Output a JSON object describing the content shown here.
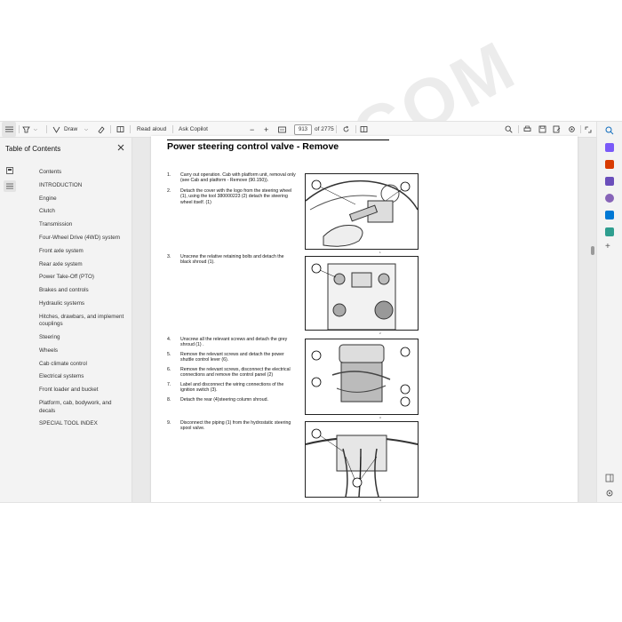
{
  "toolbar": {
    "draw_label": "Draw",
    "read_aloud_label": "Read aloud",
    "ask_copilot_label": "Ask Copilot",
    "zoom_out": "−",
    "zoom_in": "+",
    "page_current": "913",
    "page_total": "of 2775"
  },
  "toc": {
    "title": "Table of Contents",
    "items": [
      "Contents",
      "INTRODUCTION",
      "Engine",
      "Clutch",
      "Transmission",
      "Four-Wheel Drive (4WD) system",
      "Front axle system",
      "Rear axle system",
      "Power Take-Off (PTO)",
      "Brakes and controls",
      "Hydraulic systems",
      "Hitches, drawbars, and implement couplings",
      "Steering",
      "Wheels",
      "Cab climate control",
      "Electrical systems",
      "Front loader and bucket",
      "Platform, cab, bodywork, and decals",
      "SPECIAL TOOL INDEX"
    ]
  },
  "document": {
    "title": "Power steering control valve - Remove",
    "steps": [
      {
        "num": "1.",
        "text": "Carry out operation. Cab with platform unit, removal only (see Cab and platform - Remove (90.150))."
      },
      {
        "num": "2.",
        "text": "Detach the cover with the logo from the steering wheel (1), using the tool 380000223 (2) detach the steering wheel itself. (1)"
      },
      {
        "num": "3.",
        "text": "Unscrew the relative retaining bolts and detach the black shroud (1)."
      },
      {
        "num": "4.",
        "text": "Unscrew all the relevant screws and detach the grey shroud (1) ."
      },
      {
        "num": "5.",
        "text": "Remove the relevant screws and detach the power shuttle control lever (6)."
      },
      {
        "num": "6.",
        "text": "Remove the relevant screws, disconnect the electrical connections and remove the control panel (2)"
      },
      {
        "num": "7.",
        "text": "Label and disconnect the wiring connections of the ignition switch (3)."
      },
      {
        "num": "8.",
        "text": "Detach the rear (4)steering column shroud."
      },
      {
        "num": "9.",
        "text": "Disconnect the piping (1) from the hydrostatic steering spool valve."
      }
    ],
    "captions": [
      "1",
      "2",
      "3",
      "4"
    ]
  },
  "watermark": "EPC-PDF.COM",
  "colors": {
    "accent": "#0f6cbd",
    "toolbar_bg": "#f7f7f7",
    "canvas_bg": "#e9e9e9"
  }
}
